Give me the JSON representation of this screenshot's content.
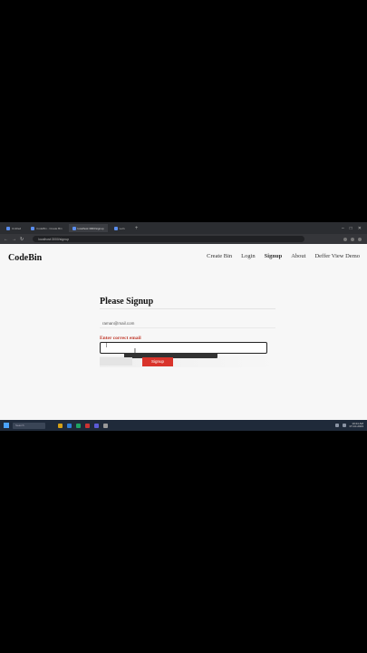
{
  "browser": {
    "tabs": [
      {
        "label": "Untitled",
        "active": false
      },
      {
        "label": "CodeBin - Create Bin",
        "active": false
      },
      {
        "label": "localhost:3000/signup",
        "active": true
      },
      {
        "label": "Let's",
        "active": false
      }
    ],
    "new_tab": "+",
    "url": "localhost:3000/signup"
  },
  "site": {
    "brand": "CodeBin",
    "nav": [
      {
        "label": "Create Bin",
        "active": false
      },
      {
        "label": "Login",
        "active": false
      },
      {
        "label": "Signup",
        "active": true
      },
      {
        "label": "About",
        "active": false
      },
      {
        "label": "Deffer View Demo",
        "active": false
      }
    ]
  },
  "form": {
    "heading": "Please Signup",
    "email_value": "raman@mail.com",
    "error_text": "Enter correct email",
    "password_value": "|",
    "button_ghost": "",
    "button_signup": "Signup"
  },
  "taskbar": {
    "search_placeholder": "Search",
    "time": "10:24 AM",
    "date": "07-10-2023"
  },
  "colors": {
    "accent_red": "#d9342b",
    "error_red": "#c0392b",
    "taskbar": "#1f2a3a"
  }
}
